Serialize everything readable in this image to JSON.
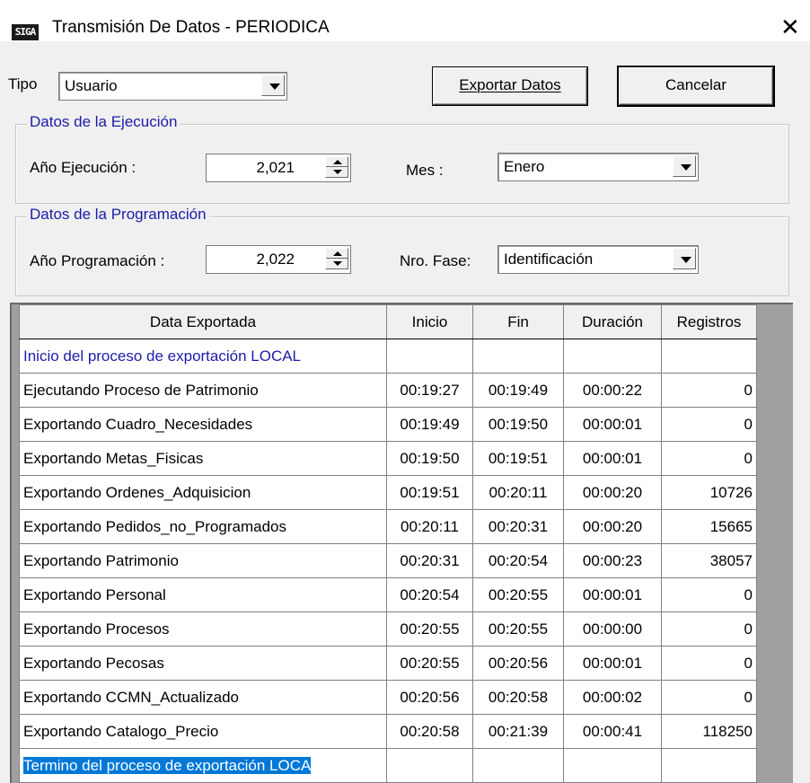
{
  "window": {
    "title": "Transmisión De Datos - PERIODICA",
    "icon_text": "SIGA",
    "close_glyph": "✕"
  },
  "toolbar": {
    "tipo_label": "Tipo",
    "tipo_value": "Usuario",
    "exportar_label": "Exportar Datos",
    "cancelar_label": "Cancelar"
  },
  "ejecucion": {
    "group_title": "Datos de la Ejecución",
    "anio_label": "Año Ejecución :",
    "anio_value": "2,021",
    "mes_label": "Mes :",
    "mes_value": "Enero"
  },
  "programacion": {
    "group_title": "Datos de la Programación",
    "anio_label": "Año Programación :",
    "anio_value": "2,022",
    "fase_label": "Nro. Fase:",
    "fase_value": "Identificación"
  },
  "grid": {
    "headers": [
      "Data Exportada",
      "Inicio",
      "Fin",
      "Duración",
      "Registros"
    ],
    "rows": [
      [
        "Inicio del proceso de exportación LOCAL",
        "",
        "",
        "",
        ""
      ],
      [
        "Ejecutando Proceso de Patrimonio",
        "00:19:27",
        "00:19:49",
        "00:00:22",
        "0"
      ],
      [
        "Exportando Cuadro_Necesidades",
        "00:19:49",
        "00:19:50",
        "00:00:01",
        "0"
      ],
      [
        "Exportando Metas_Fisicas",
        "00:19:50",
        "00:19:51",
        "00:00:01",
        "0"
      ],
      [
        "Exportando Ordenes_Adquisicion",
        "00:19:51",
        "00:20:11",
        "00:00:20",
        "10726"
      ],
      [
        "Exportando Pedidos_no_Programados",
        "00:20:11",
        "00:20:31",
        "00:00:20",
        "15665"
      ],
      [
        "Exportando Patrimonio",
        "00:20:31",
        "00:20:54",
        "00:00:23",
        "38057"
      ],
      [
        "Exportando Personal",
        "00:20:54",
        "00:20:55",
        "00:00:01",
        "0"
      ],
      [
        "Exportando Procesos",
        "00:20:55",
        "00:20:55",
        "00:00:00",
        "0"
      ],
      [
        "Exportando Pecosas",
        "00:20:55",
        "00:20:56",
        "00:00:01",
        "0"
      ],
      [
        "Exportando CCMN_Actualizado",
        "00:20:56",
        "00:20:58",
        "00:00:02",
        "0"
      ],
      [
        "Exportando Catalogo_Precio",
        "00:20:58",
        "00:21:39",
        "00:00:41",
        "118250"
      ],
      [
        "Termino del proceso de exportación LOCA",
        "",
        "",
        "",
        ""
      ]
    ],
    "row_styles": [
      "blue",
      "",
      "",
      "",
      "",
      "",
      "",
      "",
      "",
      "",
      "",
      "",
      "sel"
    ]
  },
  "colors": {
    "accent": "#0078d7",
    "group_title": "#1c1ca8",
    "background": "#f0f0f0"
  }
}
